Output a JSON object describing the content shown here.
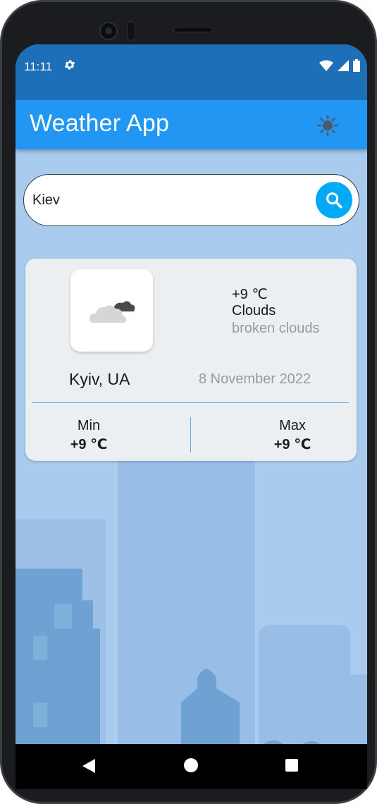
{
  "status_bar": {
    "time": "11:11",
    "icons": [
      "settings-gear-icon",
      "wifi-icon",
      "signal-icon",
      "battery-icon"
    ]
  },
  "app_bar": {
    "title": "Weather App",
    "theme_toggle_icon": "sun-icon"
  },
  "search": {
    "value": "Kiev",
    "button_icon": "search-icon"
  },
  "weather_card": {
    "icon": "broken-clouds-icon",
    "temperature": "+9 ℃",
    "condition": "Clouds",
    "description": "broken clouds",
    "city": "Kyiv, UA",
    "date": "8 November 2022",
    "min_label": "Min",
    "min_value": "+9 ℃",
    "max_label": "Max",
    "max_value": "+9 ℃"
  },
  "nav_bar": {
    "buttons": [
      "back-icon",
      "home-icon",
      "recents-icon"
    ]
  },
  "colors": {
    "status_bar": "#1d6fb8",
    "app_bar": "#2196f3",
    "search_button": "#03a9f4",
    "background": "#a9cbee",
    "divider": "#6da9d6"
  }
}
